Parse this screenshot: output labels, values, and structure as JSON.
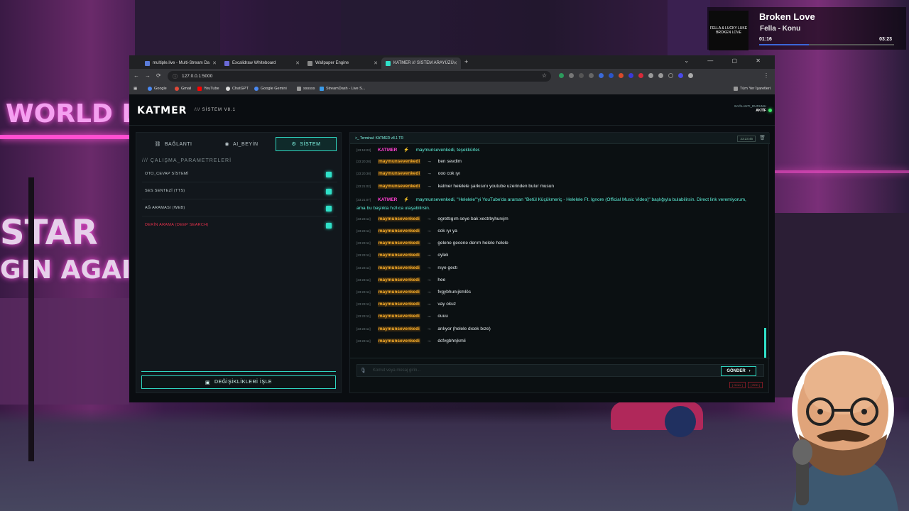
{
  "music": {
    "cover_text": [
      "FELLA & LUCKY LUKE",
      "BROKEN LOVE"
    ],
    "title": "Broken Love",
    "artist": "Fella - Konu",
    "elapsed": "01:16",
    "total": "03:23",
    "progress": 0.37
  },
  "background": {
    "sign_1": "WORLD L",
    "sign_2": "STAR",
    "sign_3": "GIN AGAIN"
  },
  "browser": {
    "tabs": [
      {
        "label": "multiple.live - Multi-Stream Da"
      },
      {
        "label": "Excalidraw Whiteboard"
      },
      {
        "label": "Wallpaper Engine"
      },
      {
        "label": "KATMER /// SİSTEM ARAYÜZÜ"
      }
    ],
    "url": "127.0.0.1:5000",
    "bookmarks": [
      "Google",
      "Gmail",
      "YouTube",
      "ChatGPT",
      "Google Gemini",
      "ssssss",
      "StreamDash - Live S..."
    ],
    "bookmarks_right": "Tüm Yer İşaretleri"
  },
  "app": {
    "logo": "KATMER",
    "subtitle": "/// SİSTEM V8.1",
    "connection_label": "BAĞLANTI_DURUMU",
    "connection_status": "AKTİF",
    "tabs": [
      {
        "label": "BAĞLANTI",
        "icon": "link-icon"
      },
      {
        "label": "AI_BEYİN",
        "icon": "brain-icon"
      },
      {
        "label": "SİSTEM",
        "icon": "gear-icon",
        "active": true
      }
    ],
    "panel_title": "/// ÇALIŞMA_PARAMETRELERİ",
    "settings": [
      {
        "label": "OTO_CEVAP SİSTEMİ",
        "enabled": true
      },
      {
        "label": "SES SENTEZİ (TTS)",
        "enabled": true
      },
      {
        "label": "AĞ ARAMASI (WEB)",
        "enabled": true
      },
      {
        "label": "DERİN ARAMA (DEEP SEARCH)",
        "enabled": true,
        "warning": true
      }
    ],
    "apply_button": "DEĞİŞİKLİKLERİ İŞLE",
    "terminal": {
      "title": ">_ Terminal: KATMER v8.1 TR",
      "time": "23:23:45",
      "input_placeholder": "Komut veya mesaj girin...",
      "send_label": "GÖNDER",
      "chips": [
        "[ OKAY ]",
        "[ RED ]"
      ],
      "messages": [
        {
          "ts": "[23:18:23]",
          "bot": true,
          "user": "KATMER",
          "text": "maymunsevenkedi, teşekkürler."
        },
        {
          "ts": "[23:20:28]",
          "user": "maymunsevenkedi",
          "text": "ben sevdim"
        },
        {
          "ts": "[23:20:38]",
          "user": "maymunsevenkedi",
          "text": "ooo cok ıyı"
        },
        {
          "ts": "[23:21:02]",
          "user": "maymunsevenkedi",
          "text": "katmer helelele şarkısını youtube uzerinden bulur musun"
        },
        {
          "ts": "[23:21:07]",
          "bot": true,
          "user": "KATMER",
          "text": "maymunsevenkedi, \"Helelele\"'yi YouTube'da ararsan \"Betül Küçükmeriç - Helelele Ft. Ignore (Official Music Video)\" başlığıyla bulabilirsin. Direct link veremiyorum, ama bu başlıkla hızlıca ulaşabilirsin."
        },
        {
          "ts": "[23:23:11]",
          "user": "maymunsevenkedi",
          "text": "ogrettıgım seye bak xectrbyhunıjm"
        },
        {
          "ts": "[23:23:11]",
          "user": "maymunsevenkedi",
          "text": "cok ıyı ya"
        },
        {
          "ts": "[23:23:11]",
          "user": "maymunsevenkedi",
          "text": "gelene gecene derım helele helele"
        },
        {
          "ts": "[23:23:11]",
          "user": "maymunsevenkedi",
          "text": "oylelı"
        },
        {
          "ts": "[23:23:11]",
          "user": "maymunsevenkedi",
          "text": "nıye gectı"
        },
        {
          "ts": "[23:23:11]",
          "user": "maymunsevenkedi",
          "text": "hee"
        },
        {
          "ts": "[23:23:11]",
          "user": "maymunsevenkedi",
          "text": "fvgybhunıjkmlös"
        },
        {
          "ts": "[23:23:11]",
          "user": "maymunsevenkedi",
          "text": "vay okuz"
        },
        {
          "ts": "[23:23:11]",
          "user": "maymunsevenkedi",
          "text": "ouuu"
        },
        {
          "ts": "[23:23:11]",
          "user": "maymunsevenkedi",
          "text": "anlıyor (helele dıcek bıze)"
        },
        {
          "ts": "[23:23:11]",
          "user": "maymunsevenkedi",
          "text": "dcfvgbhnjkmli"
        }
      ]
    }
  },
  "colors": {
    "accent": "#2fe0c8",
    "user": "#ffb22a",
    "bot": "#ff3fd0",
    "danger": "#e0304a"
  }
}
